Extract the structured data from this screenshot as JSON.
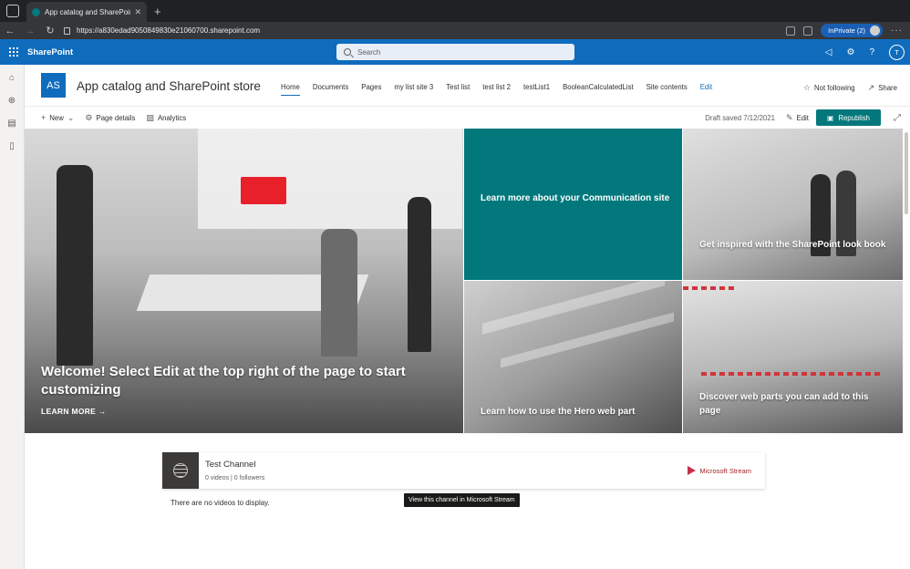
{
  "browser": {
    "tab_title": "App catalog and SharePoint st",
    "url": "https://a830edad9050849830e21060700.sharepoint.com",
    "profile_label": "InPrivate (2)"
  },
  "suite": {
    "brand": "SharePoint",
    "search_placeholder": "Search",
    "avatar_initial": "T",
    "accent": "#0f6cbd"
  },
  "site": {
    "logo_initials": "AS",
    "title": "App catalog and SharePoint store",
    "nav": [
      {
        "label": "Home"
      },
      {
        "label": "Documents"
      },
      {
        "label": "Pages"
      },
      {
        "label": "my list site 3"
      },
      {
        "label": "Test list"
      },
      {
        "label": "test list 2"
      },
      {
        "label": "testList1"
      },
      {
        "label": "BooleanCalculatedList"
      },
      {
        "label": "Site contents"
      },
      {
        "label": "Edit"
      }
    ],
    "follow_label": "Not following",
    "share_label": "Share"
  },
  "command": {
    "new_label": "New",
    "page_details_label": "Page details",
    "analytics_label": "Analytics",
    "draft_status": "Draft saved 7/12/2021",
    "edit_label": "Edit",
    "republish_label": "Republish",
    "republish_color": "#03787c"
  },
  "hero": {
    "main_caption": "Welcome! Select Edit at the top right of the page to start customizing",
    "learn_more": "LEARN MORE",
    "tile_1": "Learn more about your Communication site",
    "tile_2": "Get inspired with the SharePoint look book",
    "tile_3": "Learn how to use the Hero web part",
    "tile_4": "Discover web parts you can add to this page",
    "teal": "#03787c"
  },
  "stream": {
    "channel_name": "Test Channel",
    "channel_meta": "0 videos | 0 followers",
    "brand_label": "Microsoft Stream",
    "tooltip": "View this channel in Microsoft Stream",
    "empty_message": "There are no videos to display."
  }
}
